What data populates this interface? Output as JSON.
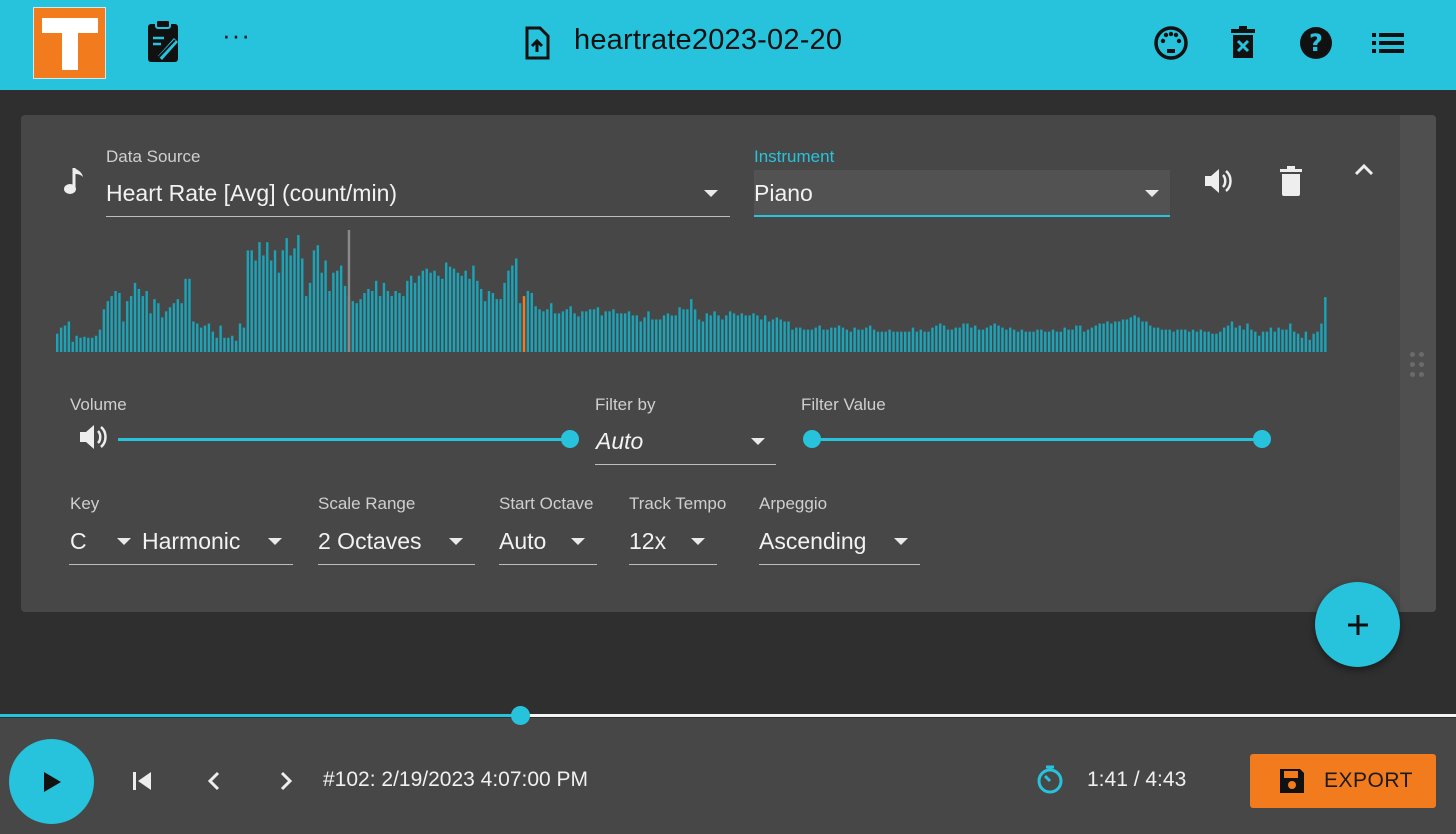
{
  "header": {
    "file_title": "heartrate2023-02-20",
    "more_label": "···",
    "icons": [
      "tonic-logo",
      "clipboard-edit-icon",
      "more-icon",
      "file-upload-icon",
      "midi-icon",
      "delete-data-icon",
      "help-icon",
      "list-icon"
    ]
  },
  "track": {
    "data_source_label": "Data Source",
    "data_source_value": "Heart Rate [Avg] (count/min)",
    "instrument_label": "Instrument",
    "instrument_value": "Piano",
    "volume_label": "Volume",
    "volume_level": 1.0,
    "filter_by_label": "Filter by",
    "filter_by_value": "Auto",
    "filter_value_label": "Filter Value",
    "filter_range": [
      0.0,
      1.0
    ],
    "key_label": "Key",
    "key_value": "C",
    "mode_value": "Harmonic",
    "scale_range_label": "Scale Range",
    "scale_range_value": "2 Octaves",
    "start_octave_label": "Start Octave",
    "start_octave_value": "Auto",
    "track_tempo_label": "Track Tempo",
    "track_tempo_value": "12x",
    "arpeggio_label": "Arpeggio",
    "arpeggio_value": "Ascending",
    "bar_color": "#1ba3b8",
    "highlight_color": "#f27b1d",
    "marker_color": "#8a8a8a"
  },
  "waveform": {
    "values": [
      18,
      24,
      26,
      30,
      10,
      16,
      14,
      15,
      14,
      14,
      16,
      22,
      42,
      50,
      55,
      60,
      58,
      30,
      50,
      55,
      68,
      62,
      55,
      60,
      38,
      52,
      48,
      34,
      40,
      44,
      48,
      52,
      48,
      72,
      72,
      30,
      28,
      24,
      26,
      28,
      20,
      14,
      26,
      14,
      14,
      16,
      11,
      28,
      24,
      100,
      100,
      90,
      108,
      95,
      108,
      90,
      100,
      78,
      100,
      112,
      95,
      102,
      115,
      92,
      55,
      68,
      100,
      105,
      78,
      90,
      60,
      78,
      80,
      85,
      65,
      55,
      50,
      48,
      52,
      58,
      62,
      60,
      70,
      55,
      68,
      60,
      55,
      60,
      58,
      55,
      70,
      75,
      68,
      75,
      80,
      82,
      78,
      80,
      75,
      72,
      88,
      84,
      82,
      78,
      75,
      80,
      72,
      85,
      70,
      62,
      50,
      60,
      58,
      52,
      52,
      68,
      80,
      85,
      92,
      48,
      55,
      60,
      58,
      45,
      42,
      40,
      42,
      48,
      38,
      38,
      40,
      42,
      45,
      38,
      35,
      40,
      40,
      42,
      42,
      44,
      36,
      40,
      40,
      42,
      38,
      38,
      38,
      40,
      36,
      36,
      30,
      34,
      40,
      32,
      32,
      32,
      36,
      38,
      36,
      36,
      44,
      42,
      42,
      52,
      42,
      32,
      30,
      38,
      36,
      40,
      36,
      32,
      36,
      40,
      38,
      36,
      38,
      36,
      36,
      38,
      36,
      32,
      36,
      30,
      32,
      34,
      32,
      30,
      30,
      22,
      24,
      24,
      22,
      22,
      22,
      24,
      26,
      22,
      22,
      24,
      24,
      26,
      24,
      22,
      20,
      24,
      22,
      22,
      24,
      26,
      22,
      20,
      20,
      20,
      22,
      20,
      20,
      20,
      20,
      20,
      24,
      20,
      22,
      20,
      20,
      24,
      26,
      28,
      26,
      22,
      22,
      24,
      24,
      28,
      28,
      24,
      26,
      22,
      22,
      24,
      26,
      28,
      26,
      24,
      22,
      24,
      22,
      20,
      22,
      20,
      20,
      20,
      22,
      22,
      20,
      20,
      22,
      20,
      20,
      24,
      22,
      22,
      26,
      26,
      20,
      22,
      24,
      26,
      28,
      28,
      30,
      28,
      30,
      30,
      32,
      32,
      34,
      36,
      34,
      30,
      30,
      26,
      24,
      24,
      22,
      22,
      22,
      20,
      22,
      22,
      22,
      20,
      22,
      20,
      22,
      20,
      20,
      18,
      18,
      20,
      24,
      26,
      30,
      24,
      26,
      22,
      28,
      22,
      20,
      16,
      20,
      20,
      24,
      20,
      24,
      22,
      22,
      28,
      20,
      18,
      14,
      20,
      12,
      18,
      20,
      28,
      54
    ],
    "highlight_index": 120,
    "marker_index": 75
  },
  "transport": {
    "progress": 0.357,
    "position_text": "#102: 2/19/2023 4:07:00 PM",
    "time_text": "1:41 / 4:43",
    "export_label": "EXPORT"
  }
}
